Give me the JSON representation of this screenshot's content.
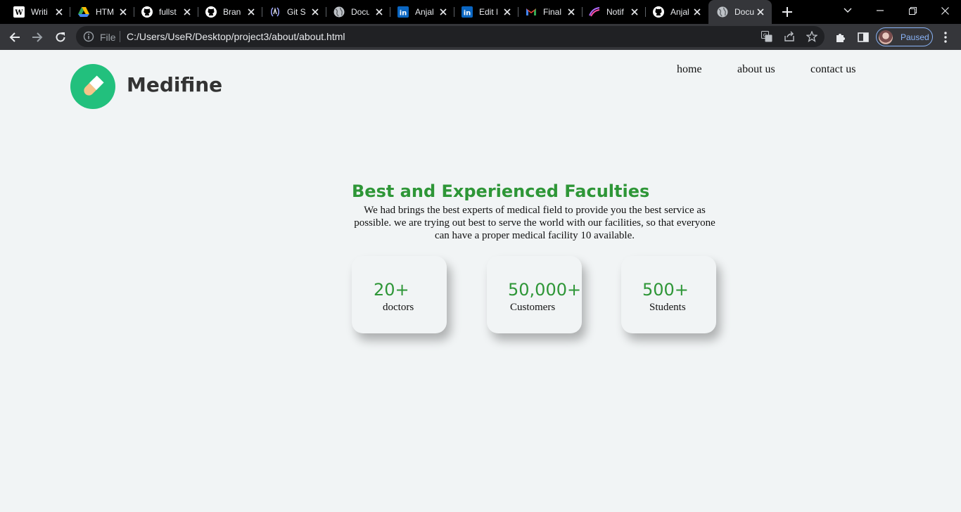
{
  "browser": {
    "tabs": [
      {
        "title": "Writi",
        "icon": "wordpress-icon"
      },
      {
        "title": "HTM",
        "icon": "google-drive-icon"
      },
      {
        "title": "fullst",
        "icon": "github-icon"
      },
      {
        "title": "Branc",
        "icon": "github-icon"
      },
      {
        "title": "Git St",
        "icon": "code-brackets-icon"
      },
      {
        "title": "Docu",
        "icon": "globe-icon"
      },
      {
        "title": "Anjal",
        "icon": "linkedin-icon"
      },
      {
        "title": "Edit M",
        "icon": "linkedin-icon"
      },
      {
        "title": "Final",
        "icon": "gmail-icon"
      },
      {
        "title": "Notif",
        "icon": "notification-icon"
      },
      {
        "title": "Anjal",
        "icon": "github-icon"
      },
      {
        "title": "Docu",
        "icon": "globe-icon",
        "active": true
      }
    ],
    "address": {
      "scheme": "File",
      "url": "C:/Users/UseR/Desktop/project3/about/about.html"
    },
    "profile_status": "Paused",
    "colors": {
      "tabbar": "#000000",
      "toolbar": "#35363a",
      "omnibox": "#202124",
      "accent": "#8ab4f8"
    }
  },
  "site": {
    "brand": "Medifine",
    "nav": [
      {
        "label": "home"
      },
      {
        "label": "about us"
      },
      {
        "label": "contact us"
      }
    ],
    "colors": {
      "logo": "#22c07d",
      "heading": "#2e9637",
      "background": "#f1f4f5"
    }
  },
  "hero": {
    "title": "Best and Experienced Faculties",
    "text": "We had brings the best experts of medical field to provide you the best service as possible. we are trying out best to serve the world with our facilities, so that everyone can have a proper medical facility 10 available."
  },
  "stats": [
    {
      "value": "20+",
      "label": "doctors"
    },
    {
      "value": "50,000+",
      "label": "Customers"
    },
    {
      "value": "500+",
      "label": "Students"
    }
  ]
}
